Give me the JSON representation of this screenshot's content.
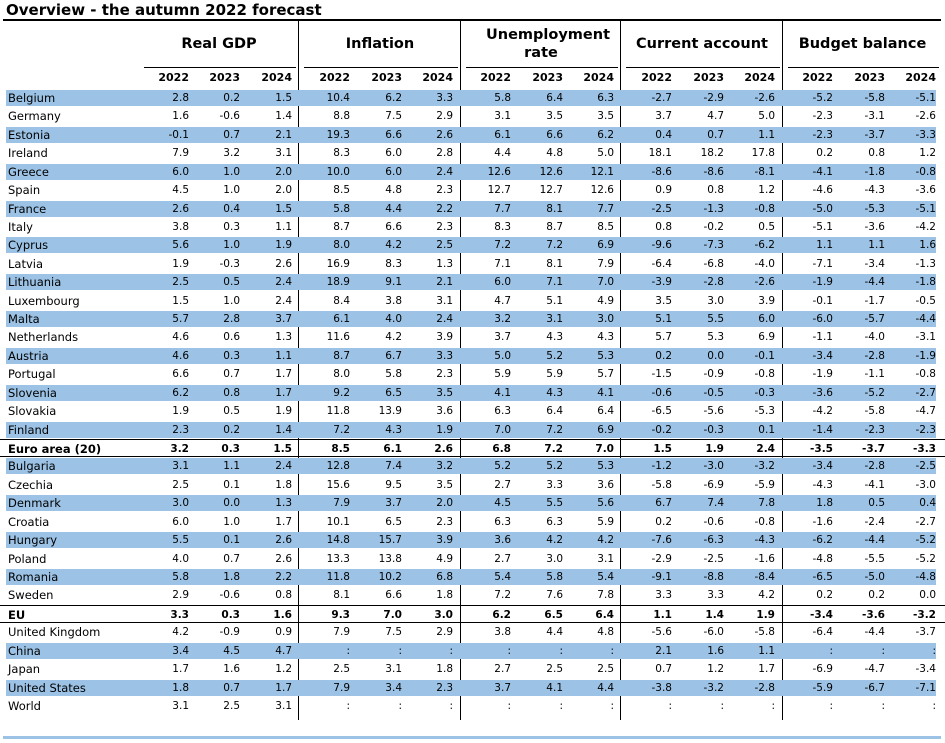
{
  "title": "Overview - the autumn 2022 forecast",
  "colors": {
    "band": "#9cc3e6",
    "rule": "#000000"
  },
  "groups": [
    {
      "label": "Real GDP",
      "years": [
        "2022",
        "2023",
        "2024"
      ]
    },
    {
      "label": "Inflation",
      "years": [
        "2022",
        "2023",
        "2024"
      ]
    },
    {
      "label": "Unemployment rate",
      "years": [
        "2022",
        "2023",
        "2024"
      ]
    },
    {
      "label": "Current account",
      "years": [
        "2022",
        "2023",
        "2024"
      ]
    },
    {
      "label": "Budget balance",
      "years": [
        "2022",
        "2023",
        "2024"
      ]
    }
  ],
  "rows": [
    {
      "country": "Belgium",
      "shaded": true,
      "values": [
        "2.8",
        "0.2",
        "1.5",
        "10.4",
        "6.2",
        "3.3",
        "5.8",
        "6.4",
        "6.3",
        "-2.7",
        "-2.9",
        "-2.6",
        "-5.2",
        "-5.8",
        "-5.1"
      ]
    },
    {
      "country": "Germany",
      "values": [
        "1.6",
        "-0.6",
        "1.4",
        "8.8",
        "7.5",
        "2.9",
        "3.1",
        "3.5",
        "3.5",
        "3.7",
        "4.7",
        "5.0",
        "-2.3",
        "-3.1",
        "-2.6"
      ]
    },
    {
      "country": "Estonia",
      "shaded": true,
      "values": [
        "-0.1",
        "0.7",
        "2.1",
        "19.3",
        "6.6",
        "2.6",
        "6.1",
        "6.6",
        "6.2",
        "0.4",
        "0.7",
        "1.1",
        "-2.3",
        "-3.7",
        "-3.3"
      ]
    },
    {
      "country": "Ireland",
      "values": [
        "7.9",
        "3.2",
        "3.1",
        "8.3",
        "6.0",
        "2.8",
        "4.4",
        "4.8",
        "5.0",
        "18.1",
        "18.2",
        "17.8",
        "0.2",
        "0.8",
        "1.2"
      ]
    },
    {
      "country": "Greece",
      "shaded": true,
      "values": [
        "6.0",
        "1.0",
        "2.0",
        "10.0",
        "6.0",
        "2.4",
        "12.6",
        "12.6",
        "12.1",
        "-8.6",
        "-8.6",
        "-8.1",
        "-4.1",
        "-1.8",
        "-0.8"
      ]
    },
    {
      "country": "Spain",
      "values": [
        "4.5",
        "1.0",
        "2.0",
        "8.5",
        "4.8",
        "2.3",
        "12.7",
        "12.7",
        "12.6",
        "0.9",
        "0.8",
        "1.2",
        "-4.6",
        "-4.3",
        "-3.6"
      ]
    },
    {
      "country": "France",
      "shaded": true,
      "values": [
        "2.6",
        "0.4",
        "1.5",
        "5.8",
        "4.4",
        "2.2",
        "7.7",
        "8.1",
        "7.7",
        "-2.5",
        "-1.3",
        "-0.8",
        "-5.0",
        "-5.3",
        "-5.1"
      ]
    },
    {
      "country": "Italy",
      "values": [
        "3.8",
        "0.3",
        "1.1",
        "8.7",
        "6.6",
        "2.3",
        "8.3",
        "8.7",
        "8.5",
        "0.8",
        "-0.2",
        "0.5",
        "-5.1",
        "-3.6",
        "-4.2"
      ]
    },
    {
      "country": "Cyprus",
      "shaded": true,
      "values": [
        "5.6",
        "1.0",
        "1.9",
        "8.0",
        "4.2",
        "2.5",
        "7.2",
        "7.2",
        "6.9",
        "-9.6",
        "-7.3",
        "-6.2",
        "1.1",
        "1.1",
        "1.6"
      ]
    },
    {
      "country": "Latvia",
      "values": [
        "1.9",
        "-0.3",
        "2.6",
        "16.9",
        "8.3",
        "1.3",
        "7.1",
        "8.1",
        "7.9",
        "-6.4",
        "-6.8",
        "-4.0",
        "-7.1",
        "-3.4",
        "-1.3"
      ]
    },
    {
      "country": "Lithuania",
      "shaded": true,
      "values": [
        "2.5",
        "0.5",
        "2.4",
        "18.9",
        "9.1",
        "2.1",
        "6.0",
        "7.1",
        "7.0",
        "-3.9",
        "-2.8",
        "-2.6",
        "-1.9",
        "-4.4",
        "-1.8"
      ]
    },
    {
      "country": "Luxembourg",
      "values": [
        "1.5",
        "1.0",
        "2.4",
        "8.4",
        "3.8",
        "3.1",
        "4.7",
        "5.1",
        "4.9",
        "3.5",
        "3.0",
        "3.9",
        "-0.1",
        "-1.7",
        "-0.5"
      ]
    },
    {
      "country": "Malta",
      "shaded": true,
      "values": [
        "5.7",
        "2.8",
        "3.7",
        "6.1",
        "4.0",
        "2.4",
        "3.2",
        "3.1",
        "3.0",
        "5.1",
        "5.5",
        "6.0",
        "-6.0",
        "-5.7",
        "-4.4"
      ]
    },
    {
      "country": "Netherlands",
      "values": [
        "4.6",
        "0.6",
        "1.3",
        "11.6",
        "4.2",
        "3.9",
        "3.7",
        "4.3",
        "4.3",
        "5.7",
        "5.3",
        "6.9",
        "-1.1",
        "-4.0",
        "-3.1"
      ]
    },
    {
      "country": "Austria",
      "shaded": true,
      "values": [
        "4.6",
        "0.3",
        "1.1",
        "8.7",
        "6.7",
        "3.3",
        "5.0",
        "5.2",
        "5.3",
        "0.2",
        "0.0",
        "-0.1",
        "-3.4",
        "-2.8",
        "-1.9"
      ]
    },
    {
      "country": "Portugal",
      "values": [
        "6.6",
        "0.7",
        "1.7",
        "8.0",
        "5.8",
        "2.3",
        "5.9",
        "5.9",
        "5.7",
        "-1.5",
        "-0.9",
        "-0.8",
        "-1.9",
        "-1.1",
        "-0.8"
      ]
    },
    {
      "country": "Slovenia",
      "shaded": true,
      "values": [
        "6.2",
        "0.8",
        "1.7",
        "9.2",
        "6.5",
        "3.5",
        "4.1",
        "4.3",
        "4.1",
        "-0.6",
        "-0.5",
        "-0.3",
        "-3.6",
        "-5.2",
        "-2.7"
      ]
    },
    {
      "country": "Slovakia",
      "values": [
        "1.9",
        "0.5",
        "1.9",
        "11.8",
        "13.9",
        "3.6",
        "6.3",
        "6.4",
        "6.4",
        "-6.5",
        "-5.6",
        "-5.3",
        "-4.2",
        "-5.8",
        "-4.7"
      ]
    },
    {
      "country": "Finland",
      "shaded": true,
      "values": [
        "2.3",
        "0.2",
        "1.4",
        "7.2",
        "4.3",
        "1.9",
        "7.0",
        "7.2",
        "6.9",
        "-0.2",
        "-0.3",
        "0.1",
        "-1.4",
        "-2.3",
        "-2.3"
      ]
    },
    {
      "country": "Euro area (20)",
      "bold": true,
      "agg": true,
      "values": [
        "3.2",
        "0.3",
        "1.5",
        "8.5",
        "6.1",
        "2.6",
        "6.8",
        "7.2",
        "7.0",
        "1.5",
        "1.9",
        "2.4",
        "-3.5",
        "-3.7",
        "-3.3"
      ]
    },
    {
      "country": "Bulgaria",
      "shaded": true,
      "values": [
        "3.1",
        "1.1",
        "2.4",
        "12.8",
        "7.4",
        "3.2",
        "5.2",
        "5.2",
        "5.3",
        "-1.2",
        "-3.0",
        "-3.2",
        "-3.4",
        "-2.8",
        "-2.5"
      ]
    },
    {
      "country": "Czechia",
      "values": [
        "2.5",
        "0.1",
        "1.8",
        "15.6",
        "9.5",
        "3.5",
        "2.7",
        "3.3",
        "3.6",
        "-5.8",
        "-6.9",
        "-5.9",
        "-4.3",
        "-4.1",
        "-3.0"
      ]
    },
    {
      "country": "Denmark",
      "shaded": true,
      "values": [
        "3.0",
        "0.0",
        "1.3",
        "7.9",
        "3.7",
        "2.0",
        "4.5",
        "5.5",
        "5.6",
        "6.7",
        "7.4",
        "7.8",
        "1.8",
        "0.5",
        "0.4"
      ]
    },
    {
      "country": "Croatia",
      "values": [
        "6.0",
        "1.0",
        "1.7",
        "10.1",
        "6.5",
        "2.3",
        "6.3",
        "6.3",
        "5.9",
        "0.2",
        "-0.6",
        "-0.8",
        "-1.6",
        "-2.4",
        "-2.7"
      ]
    },
    {
      "country": "Hungary",
      "shaded": true,
      "values": [
        "5.5",
        "0.1",
        "2.6",
        "14.8",
        "15.7",
        "3.9",
        "3.6",
        "4.2",
        "4.2",
        "-7.6",
        "-6.3",
        "-4.3",
        "-6.2",
        "-4.4",
        "-5.2"
      ]
    },
    {
      "country": "Poland",
      "values": [
        "4.0",
        "0.7",
        "2.6",
        "13.3",
        "13.8",
        "4.9",
        "2.7",
        "3.0",
        "3.1",
        "-2.9",
        "-2.5",
        "-1.6",
        "-4.8",
        "-5.5",
        "-5.2"
      ]
    },
    {
      "country": "Romania",
      "shaded": true,
      "values": [
        "5.8",
        "1.8",
        "2.2",
        "11.8",
        "10.2",
        "6.8",
        "5.4",
        "5.8",
        "5.4",
        "-9.1",
        "-8.8",
        "-8.4",
        "-6.5",
        "-5.0",
        "-4.8"
      ]
    },
    {
      "country": "Sweden",
      "values": [
        "2.9",
        "-0.6",
        "0.8",
        "8.1",
        "6.6",
        "1.8",
        "7.2",
        "7.6",
        "7.8",
        "3.3",
        "3.3",
        "4.2",
        "0.2",
        "0.2",
        "0.0"
      ]
    },
    {
      "country": "EU",
      "bold": true,
      "agg": true,
      "values": [
        "3.3",
        "0.3",
        "1.6",
        "9.3",
        "7.0",
        "3.0",
        "6.2",
        "6.5",
        "6.4",
        "1.1",
        "1.4",
        "1.9",
        "-3.4",
        "-3.6",
        "-3.2"
      ]
    },
    {
      "country": "United Kingdom",
      "values": [
        "4.2",
        "-0.9",
        "0.9",
        "7.9",
        "7.5",
        "2.9",
        "3.8",
        "4.4",
        "4.8",
        "-5.6",
        "-6.0",
        "-5.8",
        "-6.4",
        "-4.4",
        "-3.7"
      ]
    },
    {
      "country": "China",
      "shaded": true,
      "values": [
        "3.4",
        "4.5",
        "4.7",
        ":",
        ":",
        ":",
        ":",
        ":",
        ":",
        "2.1",
        "1.6",
        "1.1",
        ":",
        ":",
        ":"
      ]
    },
    {
      "country": "Japan",
      "values": [
        "1.7",
        "1.6",
        "1.2",
        "2.5",
        "3.1",
        "1.8",
        "2.7",
        "2.5",
        "2.5",
        "0.7",
        "1.2",
        "1.7",
        "-6.9",
        "-4.7",
        "-3.4"
      ]
    },
    {
      "country": "United States",
      "shaded": true,
      "values": [
        "1.8",
        "0.7",
        "1.7",
        "7.9",
        "3.4",
        "2.3",
        "3.7",
        "4.1",
        "4.4",
        "-3.8",
        "-3.2",
        "-2.8",
        "-5.9",
        "-6.7",
        "-7.1"
      ]
    },
    {
      "country": "World",
      "values": [
        "3.1",
        "2.5",
        "3.1",
        ":",
        ":",
        ":",
        ":",
        ":",
        ":",
        ":",
        ":",
        ":",
        ":",
        ":",
        ":"
      ]
    }
  ]
}
